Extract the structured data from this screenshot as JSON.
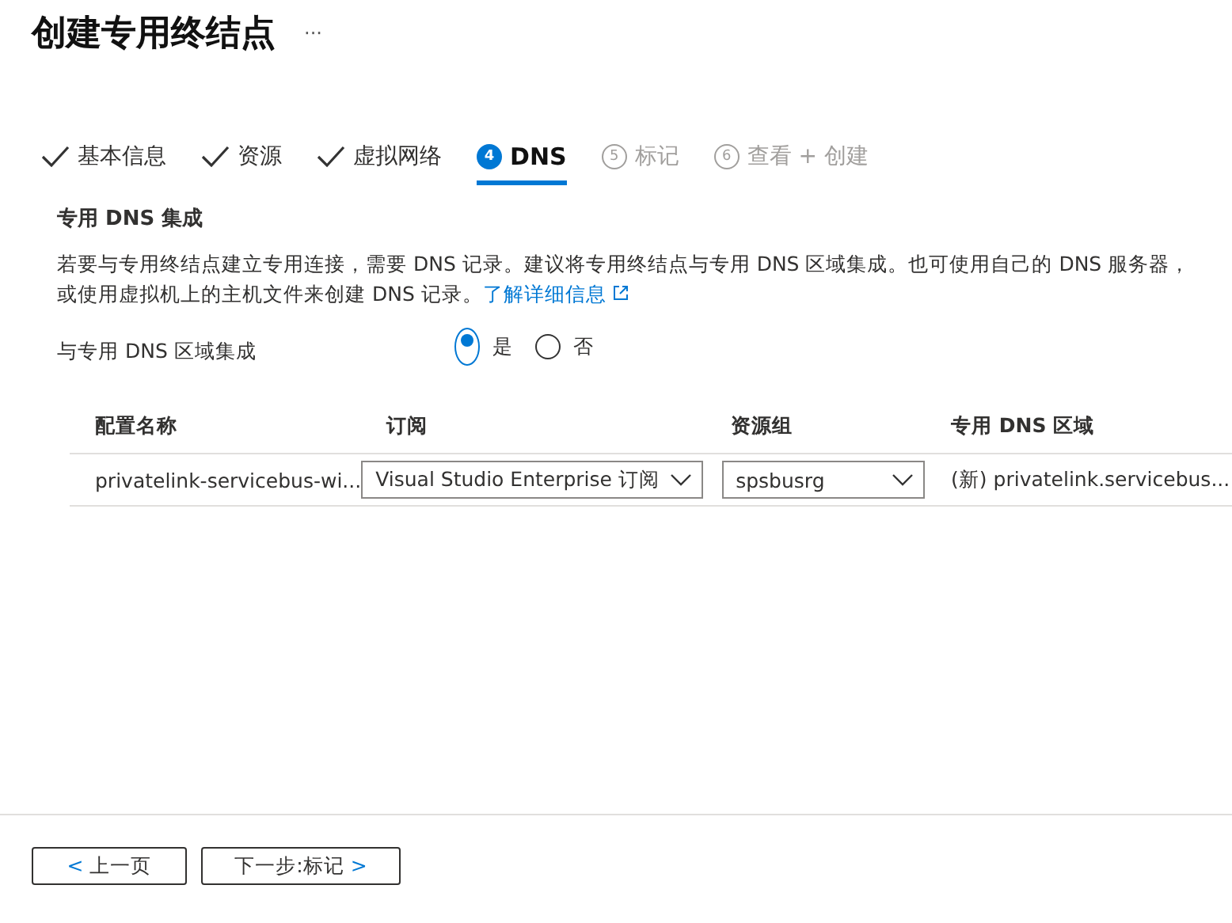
{
  "title": "创建专用终结点",
  "more": "···",
  "tabs": [
    {
      "kind": "done",
      "label": "基本信息",
      "selected": false,
      "disabled": false
    },
    {
      "kind": "done",
      "label": "资源",
      "selected": false,
      "disabled": false
    },
    {
      "kind": "done",
      "label": "虚拟网络",
      "selected": false,
      "disabled": false
    },
    {
      "kind": "step",
      "number": "4",
      "label": "DNS",
      "selected": true,
      "disabled": false
    },
    {
      "kind": "step",
      "number": "5",
      "label": "标记",
      "selected": false,
      "disabled": true
    },
    {
      "kind": "step",
      "number": "6",
      "label": "查看 + 创建",
      "selected": false,
      "disabled": true
    }
  ],
  "section": {
    "heading": "专用 DNS 集成",
    "description": "若要与专用终结点建立专用连接，需要 DNS 记录。建议将专用终结点与专用 DNS 区域集成。也可使用自己的 DNS 服务器，或使用虚拟机上的主机文件来创建 DNS 记录。",
    "link": "了解详细信息"
  },
  "integrate": {
    "label": "与专用 DNS 区域集成",
    "options": [
      {
        "label": "是",
        "selected": true
      },
      {
        "label": "否",
        "selected": false
      }
    ]
  },
  "table": {
    "columns": [
      "配置名称",
      "订阅",
      "资源组",
      "专用 DNS 区域"
    ],
    "rows": [
      {
        "name": "privatelink-servicebus-wi...",
        "subscription": "Visual Studio Enterprise 订阅",
        "resource_group": "spsbusrg",
        "zone": "(新) privatelink.servicebus..."
      }
    ]
  },
  "footer": {
    "buttons": [
      {
        "kind": "prev",
        "arrow": "<",
        "label": "上一页"
      },
      {
        "kind": "next",
        "arrow": ">",
        "label": "下一步:标记"
      }
    ]
  }
}
